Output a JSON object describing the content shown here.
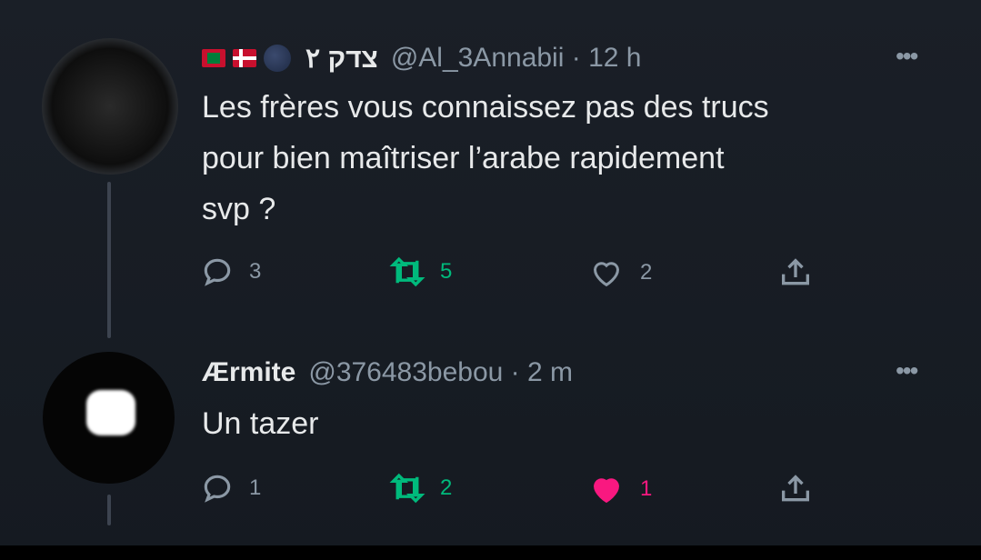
{
  "tweets": [
    {
      "display_name": "צדק ٢",
      "handle": "@Al_3Annabii",
      "time": "12 h",
      "more": "•••",
      "text_lines": [
        "Les frères vous connaissez pas des trucs",
        "pour bien maîtriser l’arabe rapidement",
        "svp ?"
      ],
      "replies": "3",
      "retweets": "5",
      "likes": "2",
      "liked": false
    },
    {
      "display_name": "Ærmite",
      "handle": "@376483bebou",
      "time": "2 m",
      "more": "•••",
      "text_lines": [
        "Un tazer"
      ],
      "replies": "1",
      "retweets": "2",
      "likes": "1",
      "liked": true
    }
  ],
  "icons": {
    "reply": "speech-bubble",
    "retweet": "retweet-arrows",
    "like": "heart",
    "share": "share-upload"
  },
  "colors": {
    "background": "#161b22",
    "text": "#e7e9ea",
    "muted": "#8b98a5",
    "retweet": "#00ba7c",
    "like_active": "#f91880"
  }
}
